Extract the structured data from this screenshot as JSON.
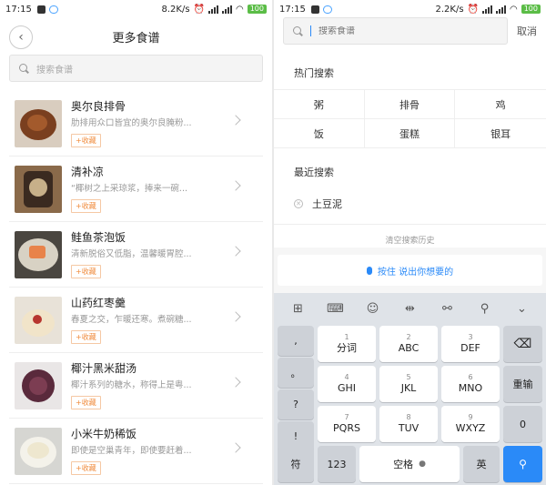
{
  "left": {
    "status": {
      "time": "17:15",
      "net": "8.2K/s",
      "battery": "100"
    },
    "title": "更多食谱",
    "search_placeholder": "搜索食谱",
    "fav_label": "+收藏",
    "recipes": [
      {
        "name": "奥尔良排骨",
        "desc": "肋排用众口皆宜的奥尔良腌粉..."
      },
      {
        "name": "清补凉",
        "desc": "“椰树之上采琼浆，捧来一碗..."
      },
      {
        "name": "鲑鱼茶泡饭",
        "desc": "清新脱俗又低脂，温馨暖胃腔..."
      },
      {
        "name": "山药红枣羹",
        "desc": "春夏之交，乍暖还寒。煮碗糖..."
      },
      {
        "name": "椰汁黑米甜汤",
        "desc": "椰汁系列的糖水，称得上是粤..."
      },
      {
        "name": "小米牛奶稀饭",
        "desc": "即使是空巢青年，即使要赶着..."
      }
    ]
  },
  "right": {
    "status": {
      "time": "17:15",
      "net": "2.2K/s",
      "battery": "100"
    },
    "search_placeholder": "搜索食谱",
    "cancel_label": "取消",
    "hot_title": "热门搜索",
    "hot_items": [
      "粥",
      "排骨",
      "鸡",
      "饭",
      "蛋糕",
      "银耳"
    ],
    "recent_title": "最近搜索",
    "recent_items": [
      "土豆泥"
    ],
    "clear_history": "清空搜索历史",
    "voice_label": "按住 说出你想要的",
    "keyboard": {
      "side_keys": [
        ",",
        "。",
        "?",
        "!"
      ],
      "keys": [
        {
          "num": "1",
          "let": "分词"
        },
        {
          "num": "2",
          "let": "ABC"
        },
        {
          "num": "3",
          "let": "DEF"
        },
        {
          "num": "4",
          "let": "GHI"
        },
        {
          "num": "5",
          "let": "JKL"
        },
        {
          "num": "6",
          "let": "MNO"
        },
        {
          "num": "7",
          "let": "PQRS"
        },
        {
          "num": "8",
          "let": "TUV"
        },
        {
          "num": "9",
          "let": "WXYZ"
        }
      ],
      "backspace_icon": "⌫",
      "reenter": "重输",
      "zero": "0",
      "symbol": "符",
      "numeric": "123",
      "space": "空格",
      "lang": "英"
    }
  }
}
